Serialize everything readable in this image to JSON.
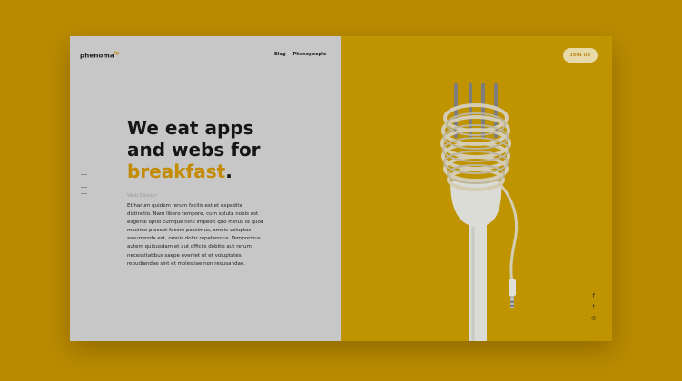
{
  "brand": {
    "logo_text": "phenoma",
    "logo_sup": "ly"
  },
  "nav": {
    "items": [
      {
        "label": "Blog"
      },
      {
        "label": "Phenopeople"
      }
    ]
  },
  "hero": {
    "line1": "We eat apps",
    "line2": "and webs for",
    "accent_word": "breakfast",
    "punct": ".",
    "subheading": "Web Design",
    "body": "Et harum quidem rerum facilis est et expedita distinctio. Nam libero tempore, cum soluta nobis est eligendi optio cumque nihil impedit quo minus id quod maxime placeat facere possimus, omnis voluptas assumenda est, omnis dolor repellendus. Temporibus autem quibusdam et aut officiis debitis aut rerum necessitatibus saepe eveniet ut et voluptates repudiandae sint et molestiae non recusandae."
  },
  "cta": {
    "join_label": "JOIN US"
  },
  "social": {
    "icons": [
      "facebook-icon",
      "twitter-icon",
      "instagram-icon"
    ],
    "glyphs": [
      "f",
      "t",
      "◎"
    ]
  },
  "colors": {
    "page_bg": "#b98a00",
    "accent": "#c48a00",
    "left_panel": "#c7c7c7",
    "right_panel": "#bf9400"
  }
}
